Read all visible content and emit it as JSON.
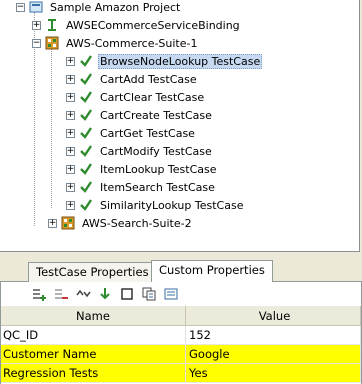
{
  "tree": {
    "project": "Sample Amazon Project",
    "binding": "AWSECommerceServiceBinding",
    "suite1": "AWS-Commerce-Suite-1",
    "testcases": [
      "BrowseNodeLookup TestCase",
      "CartAdd TestCase",
      "CartClear TestCase",
      "CartCreate TestCase",
      "CartGet TestCase",
      "CartModify TestCase",
      "ItemLookup TestCase",
      "ItemSearch TestCase",
      "SimilarityLookup TestCase"
    ],
    "selected_testcase": "BrowseNodeLookup TestCase",
    "suite2": "AWS-Search-Suite-2"
  },
  "tabs": [
    {
      "label": "TestCase Properties"
    },
    {
      "label": "Custom Properties",
      "active": true
    }
  ],
  "toolbar": {
    "icons": [
      "add-property-icon",
      "remove-property-icon",
      "move-up-down-icon",
      "load-icon",
      "clear-icon",
      "copy-icon",
      "properties-icon"
    ]
  },
  "table": {
    "headers": [
      "Name",
      "Value"
    ],
    "rows": [
      {
        "name": "QC_ID",
        "value": "152",
        "highlight": false
      },
      {
        "name": "Customer Name",
        "value": "Google",
        "highlight": true
      },
      {
        "name": "Regression Tests",
        "value": "Yes",
        "highlight": true
      }
    ]
  },
  "colors": {
    "highlight": "#ffff00",
    "selection": "#c6d9f0",
    "check": "#2e8b2e"
  }
}
